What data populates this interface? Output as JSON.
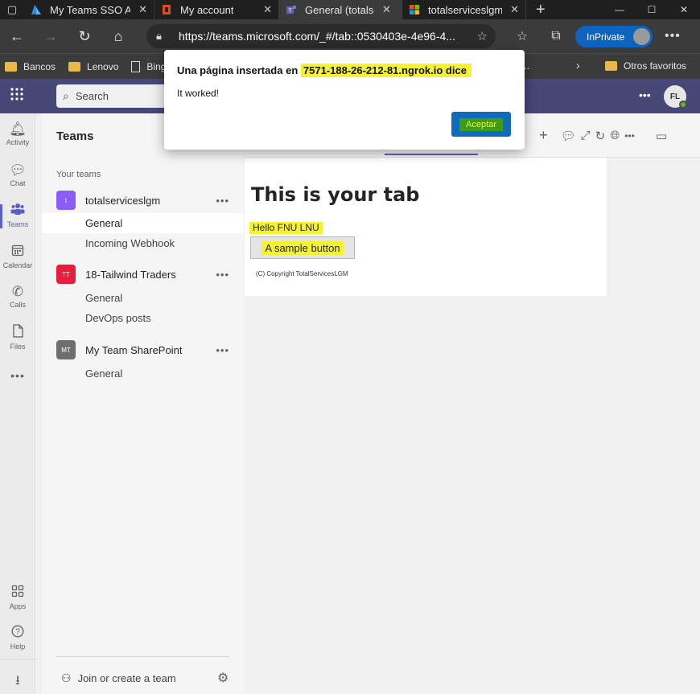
{
  "browser": {
    "tabs": [
      {
        "label": "My Teams SSO A",
        "icon": "azure-icon",
        "active": false
      },
      {
        "label": "My account",
        "icon": "office-icon",
        "active": false
      },
      {
        "label": "General (totalser",
        "icon": "teams-icon",
        "active": true
      },
      {
        "label": "totalserviceslgm",
        "icon": "microsoft-icon",
        "active": false
      }
    ],
    "url": "https://teams.microsoft.com/_#/tab::0530403e-4e96-4...",
    "inprivate_label": "InPrivate",
    "favorites": [
      {
        "label": "Bancos",
        "type": "folder"
      },
      {
        "label": "Lenovo",
        "type": "folder"
      },
      {
        "label": "Bing",
        "type": "page"
      }
    ],
    "other_favorites": "Otros favoritos"
  },
  "teams_header": {
    "search_placeholder": "Search",
    "user_initials": "FL"
  },
  "rail": {
    "items": [
      {
        "label": "Activity",
        "icon": "bell-icon"
      },
      {
        "label": "Chat",
        "icon": "chat-icon"
      },
      {
        "label": "Teams",
        "icon": "teams-icon",
        "active": true
      },
      {
        "label": "Calendar",
        "icon": "calendar-icon"
      },
      {
        "label": "Calls",
        "icon": "phone-icon"
      },
      {
        "label": "Files",
        "icon": "file-icon"
      },
      {
        "label": "Apps",
        "icon": "apps-icon"
      },
      {
        "label": "Help",
        "icon": "help-icon"
      }
    ]
  },
  "teams_panel": {
    "title": "Teams",
    "section_label": "Your teams",
    "teams": [
      {
        "name": "totalserviceslgm",
        "initials": "t",
        "color": "#8b5cf6",
        "channels": [
          "General",
          "Incoming Webhook"
        ]
      },
      {
        "name": "18-Tailwind Traders",
        "initials": "TT",
        "color": "#e81c3c",
        "channels": [
          "General",
          "DevOps posts"
        ]
      },
      {
        "name": "My Team SharePoint",
        "initials": "MT",
        "color": "#6e6e6e",
        "channels": [
          "General"
        ]
      }
    ],
    "join_label": "Join or create a team"
  },
  "tab_content": {
    "heading": "This is your tab",
    "greeting": "Hello FNU LNU",
    "button_label": "A sample button",
    "copyright": "(C) Copyright TotalServicesLGM"
  },
  "dialog": {
    "title_prefix": "Una página insertada en ",
    "host": "7571-188-26-212-81.ngrok.io dice",
    "message": "It worked!",
    "ok_label": "Aceptar"
  },
  "colors": {
    "teams_purple": "#464775",
    "accent": "#5b5fc7",
    "highlight": "#f5f232"
  }
}
